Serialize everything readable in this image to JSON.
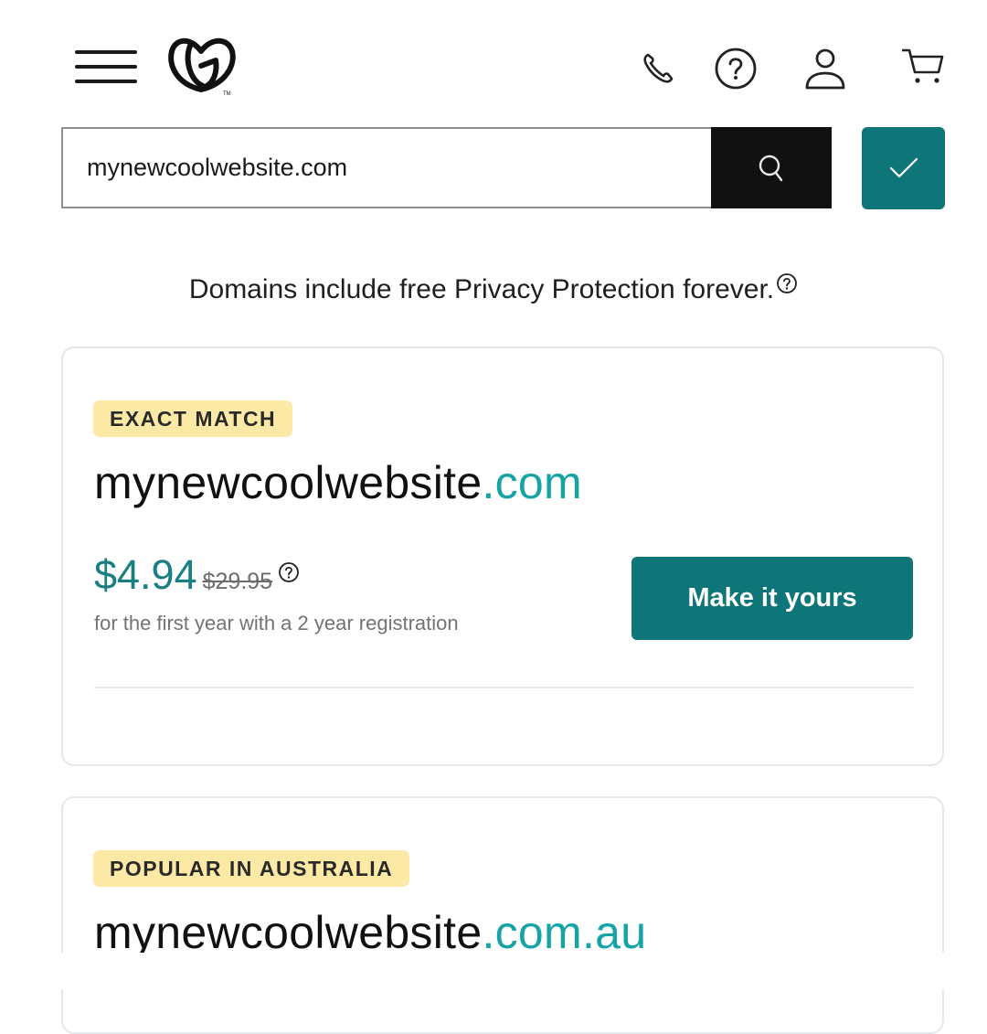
{
  "header": {
    "menu_icon": "hamburger-menu-icon",
    "logo": "godaddy-logo",
    "icons": [
      "phone-icon",
      "help-icon",
      "account-icon",
      "cart-icon"
    ]
  },
  "search": {
    "value": "mynewcoolwebsite.com",
    "search_button_icon": "search-icon",
    "confirm_button_icon": "check-icon"
  },
  "privacy_notice": "Domains include free Privacy Protection forever.",
  "colors": {
    "brand_teal": "#0e7578",
    "tld_teal": "#15a3a6",
    "badge_yellow": "#fde9a6"
  },
  "results": [
    {
      "badge": "EXACT MATCH",
      "domain_name": "mynewcoolwebsite",
      "tld": ".com",
      "price": "$4.94",
      "original_price": "$29.95",
      "price_note": "for the first year with a 2 year registration",
      "cta": "Make it yours"
    },
    {
      "badge": "POPULAR IN AUSTRALIA",
      "domain_name": "mynewcoolwebsite",
      "tld": ".com.au"
    }
  ]
}
